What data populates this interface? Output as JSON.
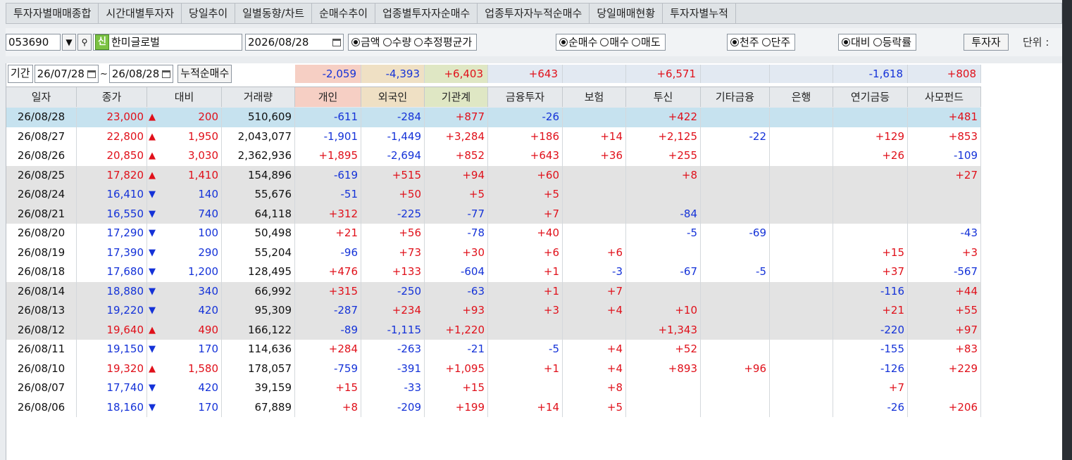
{
  "tabs": [
    "투자자별매매종합",
    "시간대별투자자",
    "당일추이",
    "일별동향/차트",
    "순매수추이",
    "업종별투자자순매수",
    "업종투자자누적순매수",
    "당일매매현황",
    "투자자별누적"
  ],
  "toolbar": {
    "code": "053690",
    "badge": "신",
    "name": "한미글로벌",
    "date": "2026/08/28",
    "radio1": [
      {
        "label": "금액",
        "on": true
      },
      {
        "label": "수량",
        "on": false
      },
      {
        "label": "추정평균가",
        "on": false
      }
    ],
    "radio2": [
      {
        "label": "순매수",
        "on": true
      },
      {
        "label": "매수",
        "on": false
      },
      {
        "label": "매도",
        "on": false
      }
    ],
    "radio3": [
      {
        "label": "천주",
        "on": true
      },
      {
        "label": "단주",
        "on": false
      }
    ],
    "radio4": [
      {
        "label": "대비",
        "on": true
      },
      {
        "label": "등락률",
        "on": false
      }
    ],
    "investor_button": "투자자",
    "unit_label": "단위 :"
  },
  "period": {
    "label": "기간",
    "from": "26/07/28",
    "tilde": "~",
    "to": "26/08/28",
    "cumulative_label": "누적순매수"
  },
  "summary": [
    "-2,059",
    "-4,393",
    "+6,403",
    "+643",
    "",
    "+6,571",
    "",
    "",
    "-1,618",
    "+808"
  ],
  "headers": [
    "일자",
    "종가",
    "대비",
    "거래량",
    "개인",
    "외국인",
    "기관계",
    "금융투자",
    "보험",
    "투신",
    "기타금융",
    "은행",
    "연기금등",
    "사모펀드"
  ],
  "rows": [
    {
      "date": "26/08/28",
      "close": "23,000",
      "dir": "up",
      "chg": "200",
      "vol": "510,609",
      "v": [
        "-611",
        "-284",
        "+877",
        "-26",
        "",
        "+422",
        "",
        "",
        "",
        "+481"
      ],
      "style": "sel"
    },
    {
      "date": "26/08/27",
      "close": "22,800",
      "dir": "up",
      "chg": "1,950",
      "vol": "2,043,077",
      "v": [
        "-1,901",
        "-1,449",
        "+3,284",
        "+186",
        "+14",
        "+2,125",
        "-22",
        "",
        "+129",
        "+853"
      ],
      "style": ""
    },
    {
      "date": "26/08/26",
      "close": "20,850",
      "dir": "up",
      "chg": "3,030",
      "vol": "2,362,936",
      "v": [
        "+1,895",
        "-2,694",
        "+852",
        "+643",
        "+36",
        "+255",
        "",
        "",
        "+26",
        "-109"
      ],
      "style": ""
    },
    {
      "date": "26/08/25",
      "close": "17,820",
      "dir": "up",
      "chg": "1,410",
      "vol": "154,896",
      "v": [
        "-619",
        "+515",
        "+94",
        "+60",
        "",
        "+8",
        "",
        "",
        "",
        "+27"
      ],
      "style": "gray"
    },
    {
      "date": "26/08/24",
      "close": "16,410",
      "dir": "down",
      "chg": "140",
      "vol": "55,676",
      "v": [
        "-51",
        "+50",
        "+5",
        "+5",
        "",
        "",
        "",
        "",
        "",
        ""
      ],
      "style": "gray"
    },
    {
      "date": "26/08/21",
      "close": "16,550",
      "dir": "down",
      "chg": "740",
      "vol": "64,118",
      "v": [
        "+312",
        "-225",
        "-77",
        "+7",
        "",
        "-84",
        "",
        "",
        "",
        ""
      ],
      "style": "gray"
    },
    {
      "date": "26/08/20",
      "close": "17,290",
      "dir": "down",
      "chg": "100",
      "vol": "50,498",
      "v": [
        "+21",
        "+56",
        "-78",
        "+40",
        "",
        "-5",
        "-69",
        "",
        "",
        "-43"
      ],
      "style": ""
    },
    {
      "date": "26/08/19",
      "close": "17,390",
      "dir": "down",
      "chg": "290",
      "vol": "55,204",
      "v": [
        "-96",
        "+73",
        "+30",
        "+6",
        "+6",
        "",
        "",
        "",
        "+15",
        "+3"
      ],
      "style": ""
    },
    {
      "date": "26/08/18",
      "close": "17,680",
      "dir": "down",
      "chg": "1,200",
      "vol": "128,495",
      "v": [
        "+476",
        "+133",
        "-604",
        "+1",
        "-3",
        "-67",
        "-5",
        "",
        "+37",
        "-567"
      ],
      "style": ""
    },
    {
      "date": "26/08/14",
      "close": "18,880",
      "dir": "down",
      "chg": "340",
      "vol": "66,992",
      "v": [
        "+315",
        "-250",
        "-63",
        "+1",
        "+7",
        "",
        "",
        "",
        "-116",
        "+44"
      ],
      "style": "gray"
    },
    {
      "date": "26/08/13",
      "close": "19,220",
      "dir": "down",
      "chg": "420",
      "vol": "95,309",
      "v": [
        "-287",
        "+234",
        "+93",
        "+3",
        "+4",
        "+10",
        "",
        "",
        "+21",
        "+55"
      ],
      "style": "gray"
    },
    {
      "date": "26/08/12",
      "close": "19,640",
      "dir": "up",
      "chg": "490",
      "vol": "166,122",
      "v": [
        "-89",
        "-1,115",
        "+1,220",
        "",
        "",
        "+1,343",
        "",
        "",
        "-220",
        "+97"
      ],
      "style": "gray"
    },
    {
      "date": "26/08/11",
      "close": "19,150",
      "dir": "down",
      "chg": "170",
      "vol": "114,636",
      "v": [
        "+284",
        "-263",
        "-21",
        "-5",
        "+4",
        "+52",
        "",
        "",
        "-155",
        "+83"
      ],
      "style": ""
    },
    {
      "date": "26/08/10",
      "close": "19,320",
      "dir": "up",
      "chg": "1,580",
      "vol": "178,057",
      "v": [
        "-759",
        "-391",
        "+1,095",
        "+1",
        "+4",
        "+893",
        "+96",
        "",
        "-126",
        "+229"
      ],
      "style": ""
    },
    {
      "date": "26/08/07",
      "close": "17,740",
      "dir": "down",
      "chg": "420",
      "vol": "39,159",
      "v": [
        "+15",
        "-33",
        "+15",
        "",
        "+8",
        "",
        "",
        "",
        "+7",
        ""
      ],
      "style": ""
    },
    {
      "date": "26/08/06",
      "close": "18,160",
      "dir": "down",
      "chg": "170",
      "vol": "67,889",
      "v": [
        "+8",
        "-209",
        "+199",
        "+14",
        "+5",
        "",
        "",
        "",
        "-26",
        "+206"
      ],
      "style": ""
    }
  ],
  "colors": {
    "up": "#e0101a",
    "down": "#1432d8",
    "selected_row": "#c6e2ef",
    "shaded_row": "#e3e3e3",
    "individual_bg": "#f6cfc4",
    "foreign_bg": "#efe0c4",
    "institution_bg": "#dfe7c4"
  }
}
